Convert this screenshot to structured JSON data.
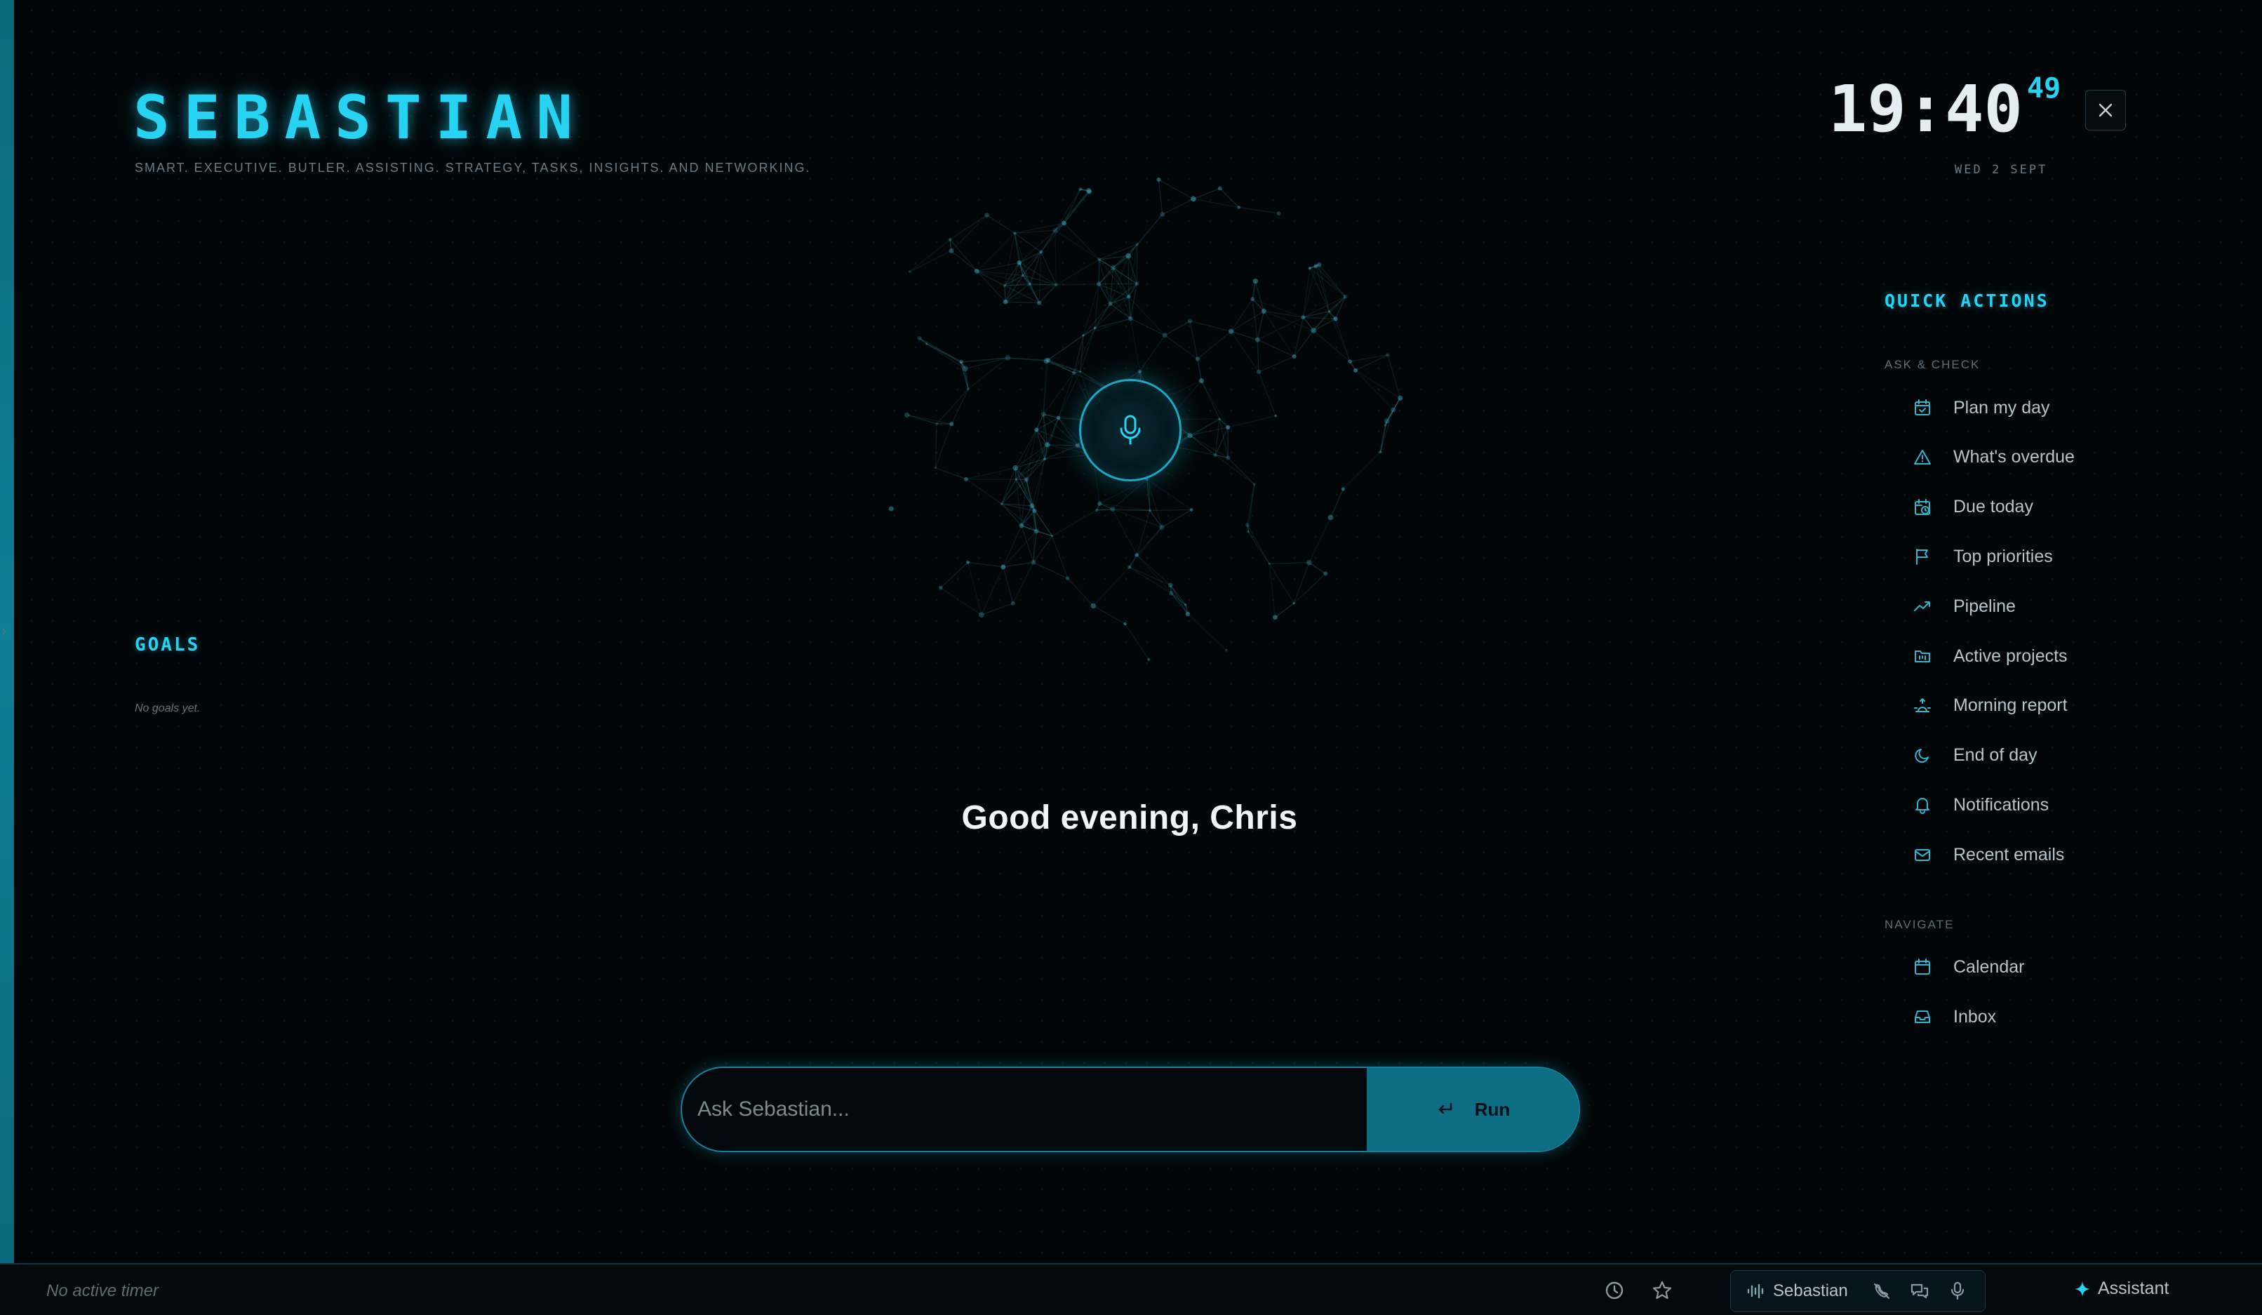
{
  "brand": {
    "title": "SEBASTIAN",
    "tagline": "SMART. EXECUTIVE. BUTLER. ASSISTING. STRATEGY, TASKS, INSIGHTS. AND NETWORKING."
  },
  "clock": {
    "time": "19:40",
    "seconds": "49",
    "date": "WED 2 SEPT"
  },
  "goals": {
    "title": "GOALS",
    "empty_text": "No goals yet."
  },
  "greeting": "Good evening, Chris",
  "ask": {
    "placeholder": "Ask Sebastian...",
    "run_label": "Run"
  },
  "quick_actions": {
    "title": "QUICK ACTIONS",
    "section_ask": "ASK & CHECK",
    "ask_items": [
      {
        "label": "Plan my day",
        "icon": "calendar-check-icon"
      },
      {
        "label": "What's overdue",
        "icon": "warning-icon"
      },
      {
        "label": "Due today",
        "icon": "calendar-clock-icon"
      },
      {
        "label": "Top priorities",
        "icon": "flag-icon"
      },
      {
        "label": "Pipeline",
        "icon": "trending-up-icon"
      },
      {
        "label": "Active projects",
        "icon": "folder-kanban-icon"
      },
      {
        "label": "Morning report",
        "icon": "sunrise-icon"
      },
      {
        "label": "End of day",
        "icon": "moon-icon"
      },
      {
        "label": "Notifications",
        "icon": "bell-icon"
      },
      {
        "label": "Recent emails",
        "icon": "mail-icon"
      }
    ],
    "section_nav": "NAVIGATE",
    "nav_items": [
      {
        "label": "Calendar",
        "icon": "calendar-icon"
      },
      {
        "label": "Inbox",
        "icon": "inbox-icon"
      }
    ]
  },
  "bottom_bar": {
    "timer_text": "No active timer",
    "voice_label": "Sebastian",
    "assistant_label": "Assistant"
  },
  "colors": {
    "accent": "#26d3f2",
    "run_button": "#0d6d82",
    "background": "#020608"
  }
}
